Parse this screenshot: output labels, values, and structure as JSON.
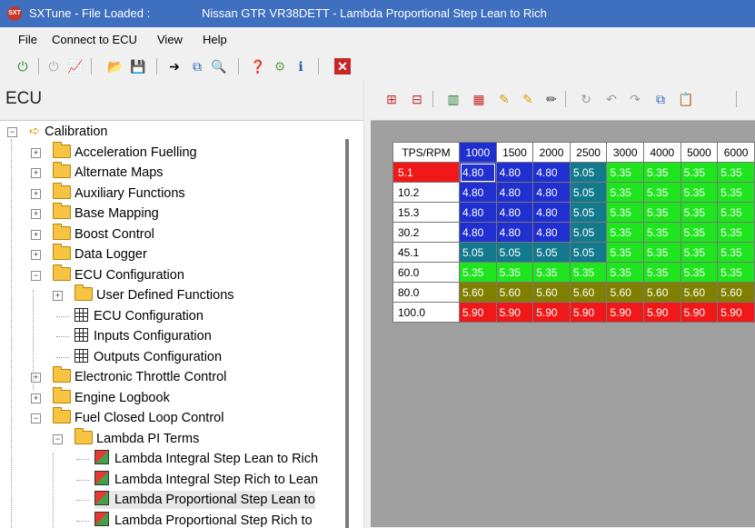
{
  "window": {
    "app_title": "SXTune - File Loaded :",
    "doc_title": "Nissan GTR VR38DETT - Lambda Proportional Step Lean to Rich",
    "logo_text": "SXT"
  },
  "menu": [
    "File",
    "Connect to ECU",
    "View",
    "Help"
  ],
  "toolbar_icons": [
    "power-icon",
    "disconnect-icon",
    "graph-icon",
    "open-folder-icon",
    "save-icon",
    "arrow-icon",
    "copy-icon",
    "search-icon",
    "help-icon",
    "gear-icon",
    "info-icon",
    "close-icon"
  ],
  "left_panel": {
    "header": "ECU",
    "tree": [
      {
        "label": "Calibration",
        "level": 0,
        "type": "root",
        "expander": "−"
      },
      {
        "label": "Acceleration Fuelling",
        "level": 1,
        "type": "folder",
        "expander": "+"
      },
      {
        "label": "Alternate Maps",
        "level": 1,
        "type": "folder",
        "expander": "+"
      },
      {
        "label": "Auxiliary Functions",
        "level": 1,
        "type": "folder",
        "expander": "+"
      },
      {
        "label": "Base Mapping",
        "level": 1,
        "type": "folder",
        "expander": "+"
      },
      {
        "label": "Boost Control",
        "level": 1,
        "type": "folder",
        "expander": "+"
      },
      {
        "label": "Data Logger",
        "level": 1,
        "type": "folder",
        "expander": "+"
      },
      {
        "label": "ECU Configuration",
        "level": 1,
        "type": "folder",
        "expander": "−"
      },
      {
        "label": "User Defined Functions",
        "level": 2,
        "type": "folder",
        "expander": "+"
      },
      {
        "label": "ECU Configuration",
        "level": 2,
        "type": "table"
      },
      {
        "label": "Inputs Configuration",
        "level": 2,
        "type": "table"
      },
      {
        "label": "Outputs Configuration",
        "level": 2,
        "type": "table"
      },
      {
        "label": "Electronic Throttle Control",
        "level": 1,
        "type": "folder",
        "expander": "+"
      },
      {
        "label": "Engine Logbook",
        "level": 1,
        "type": "folder",
        "expander": "+"
      },
      {
        "label": "Fuel Closed Loop Control",
        "level": 1,
        "type": "folder",
        "expander": "−"
      },
      {
        "label": "Lambda PI Terms",
        "level": 2,
        "type": "folder",
        "expander": "−"
      },
      {
        "label": "Lambda Integral Step Lean to Rich",
        "level": 3,
        "type": "map"
      },
      {
        "label": "Lambda Integral Step Rich to Lean",
        "level": 3,
        "type": "map"
      },
      {
        "label": "Lambda Proportional Step Lean to",
        "level": 3,
        "type": "map",
        "selected": true
      },
      {
        "label": "Lambda Proportional Step Rich to",
        "level": 3,
        "type": "map"
      }
    ]
  },
  "right_toolbar_icons": [
    "insert-row-icon",
    "delete-row-icon",
    "insert-column-icon",
    "delete-column-icon",
    "edit-icon",
    "edit-check-icon",
    "pencil-icon",
    "refresh-icon",
    "undo-icon",
    "redo-icon",
    "copy-icon",
    "paste-icon"
  ],
  "table": {
    "corner": "TPS/RPM",
    "columns": [
      "1000",
      "1500",
      "2000",
      "2500",
      "3000",
      "4000",
      "5000",
      "6000"
    ],
    "rows": [
      {
        "tps": "5.1",
        "values": [
          "4.80",
          "4.80",
          "4.80",
          "5.05",
          "5.35",
          "5.35",
          "5.35",
          "5.35"
        ]
      },
      {
        "tps": "10.2",
        "values": [
          "4.80",
          "4.80",
          "4.80",
          "5.05",
          "5.35",
          "5.35",
          "5.35",
          "5.35"
        ]
      },
      {
        "tps": "15.3",
        "values": [
          "4.80",
          "4.80",
          "4.80",
          "5.05",
          "5.35",
          "5.35",
          "5.35",
          "5.35"
        ]
      },
      {
        "tps": "30.2",
        "values": [
          "4.80",
          "4.80",
          "4.80",
          "5.05",
          "5.35",
          "5.35",
          "5.35",
          "5.35"
        ]
      },
      {
        "tps": "45.1",
        "values": [
          "5.05",
          "5.05",
          "5.05",
          "5.05",
          "5.35",
          "5.35",
          "5.35",
          "5.35"
        ]
      },
      {
        "tps": "60.0",
        "values": [
          "5.35",
          "5.35",
          "5.35",
          "5.35",
          "5.35",
          "5.35",
          "5.35",
          "5.35"
        ]
      },
      {
        "tps": "80.0",
        "values": [
          "5.60",
          "5.60",
          "5.60",
          "5.60",
          "5.60",
          "5.60",
          "5.60",
          "5.60"
        ]
      },
      {
        "tps": "100.0",
        "values": [
          "5.90",
          "5.90",
          "5.90",
          "5.90",
          "5.90",
          "5.90",
          "5.90",
          "5.90"
        ]
      }
    ],
    "value_colors": {
      "4.80": "#1f2fd0",
      "5.05": "#137a8e",
      "5.35": "#1ee51e",
      "5.60": "#808000",
      "5.90": "#f01818"
    },
    "selected_cell": {
      "row": 0,
      "col": 0
    },
    "selected_row_header_color": "#f01818",
    "selected_col_header_color": "#1f2fd0"
  },
  "colors": {
    "titlebar": "#3f6fbf"
  }
}
